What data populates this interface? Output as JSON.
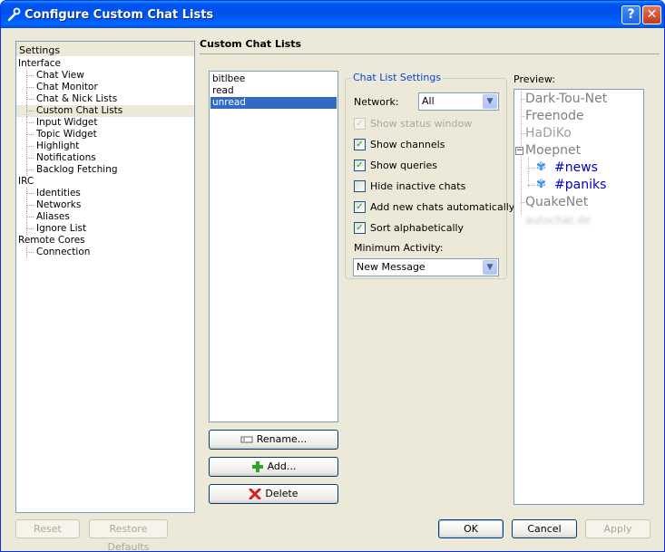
{
  "window": {
    "title": "Configure Custom Chat Lists"
  },
  "titlebar": {
    "help_label": "?",
    "close_label": "✕"
  },
  "settings": {
    "header": "Settings",
    "tree": [
      {
        "label": "Interface",
        "level": 0
      },
      {
        "label": "Chat View",
        "level": 1
      },
      {
        "label": "Chat Monitor",
        "level": 1
      },
      {
        "label": "Chat & Nick Lists",
        "level": 1
      },
      {
        "label": "Custom Chat Lists",
        "level": 1,
        "selected": true
      },
      {
        "label": "Input Widget",
        "level": 1
      },
      {
        "label": "Topic Widget",
        "level": 1
      },
      {
        "label": "Highlight",
        "level": 1
      },
      {
        "label": "Notifications",
        "level": 1
      },
      {
        "label": "Backlog Fetching",
        "level": 1
      },
      {
        "label": "IRC",
        "level": 0
      },
      {
        "label": "Identities",
        "level": 1
      },
      {
        "label": "Networks",
        "level": 1
      },
      {
        "label": "Aliases",
        "level": 1
      },
      {
        "label": "Ignore List",
        "level": 1
      },
      {
        "label": "Remote Cores",
        "level": 0
      },
      {
        "label": "Connection",
        "level": 1
      }
    ]
  },
  "page": {
    "title": "Custom Chat Lists"
  },
  "chat_lists": {
    "items": [
      "bitlbee",
      "read",
      "unread"
    ],
    "selected": "unread",
    "rename_label": "Rename...",
    "add_label": "Add...",
    "delete_label": "Delete"
  },
  "chat_list_settings": {
    "group_title": "Chat List Settings",
    "network_label": "Network:",
    "network_value": "All",
    "checkboxes": [
      {
        "label": "Show status window",
        "checked": true,
        "disabled": true
      },
      {
        "label": "Show channels",
        "checked": true,
        "disabled": false
      },
      {
        "label": "Show queries",
        "checked": true,
        "disabled": false
      },
      {
        "label": "Hide inactive chats",
        "checked": false,
        "disabled": false
      },
      {
        "label": "Add new chats automatically",
        "checked": true,
        "disabled": false
      },
      {
        "label": "Sort alphabetically",
        "checked": true,
        "disabled": false
      }
    ],
    "min_activity_label": "Minimum Activity:",
    "min_activity_value": "New Message"
  },
  "preview": {
    "label": "Preview:",
    "items": [
      {
        "label": "Dark-Tou-Net"
      },
      {
        "label": "Freenode"
      },
      {
        "label": "HaDiKo"
      },
      {
        "label": "Moepnet"
      },
      {
        "label": "#news"
      },
      {
        "label": "#paniks"
      },
      {
        "label": "QuakeNet"
      },
      {
        "label": "autochat.de"
      }
    ]
  },
  "footer": {
    "reset_label": "Reset",
    "restore_label": "Restore Defaults",
    "ok_label": "OK",
    "cancel_label": "Cancel",
    "apply_label": "Apply"
  }
}
